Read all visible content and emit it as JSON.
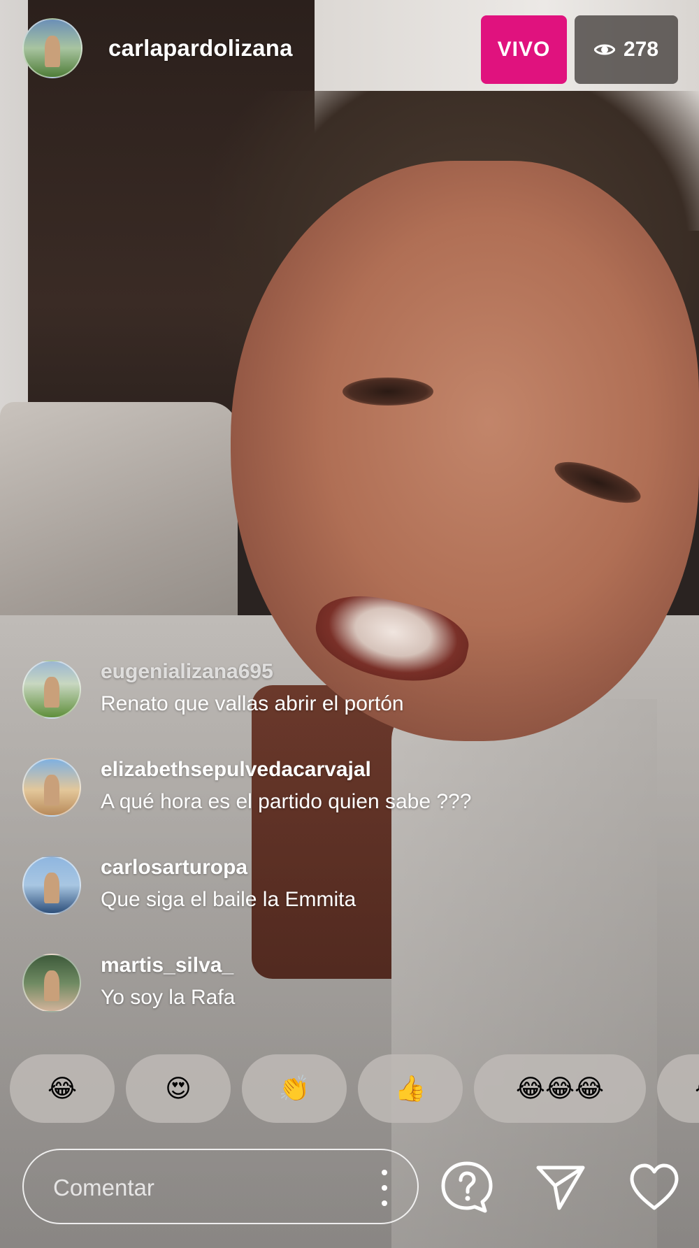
{
  "header": {
    "host_username": "carlapardolizana",
    "live_label": "VIVO",
    "viewer_count": "278",
    "live_color": "#E0127E"
  },
  "comments": [
    {
      "username": "eugenializana695",
      "text": "Renato que vallas abrir el portón"
    },
    {
      "username": "elizabethsepulvedacarvajal",
      "text": "A qué hora es el partido quien sabe ???"
    },
    {
      "username": "carlosarturopa",
      "text": "Que siga el baile la Emmita"
    },
    {
      "username": "martis_silva_",
      "text": "Yo soy la Rafa"
    }
  ],
  "reactions": [
    "😂",
    "😍",
    "👏",
    "👍",
    "😂😂😂",
    "😂"
  ],
  "composer": {
    "placeholder": "Comentar"
  },
  "icons": {
    "more": "more-vertical-icon",
    "qa": "question-bubble-icon",
    "send": "paper-plane-icon",
    "like": "heart-icon",
    "viewers": "eye-icon"
  }
}
